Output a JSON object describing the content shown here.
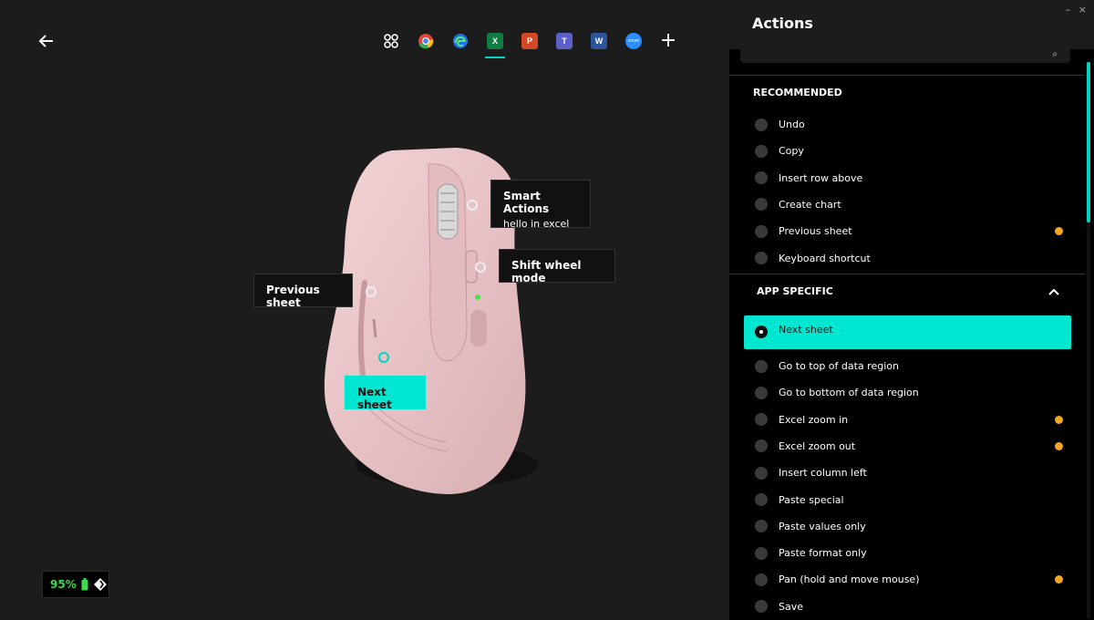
{
  "window": {
    "minimize": "–",
    "close": "×"
  },
  "apps": [
    {
      "name": "all-apps",
      "label": "",
      "color": "#ffffff"
    },
    {
      "name": "chrome",
      "label": "",
      "color": "#ea4335"
    },
    {
      "name": "edge",
      "label": "",
      "color": "#1a73e8"
    },
    {
      "name": "excel",
      "label": "X",
      "color": "#107c41",
      "active": true
    },
    {
      "name": "powerpoint",
      "label": "P",
      "color": "#d24726"
    },
    {
      "name": "teams",
      "label": "T",
      "color": "#5b5fc7"
    },
    {
      "name": "word",
      "label": "W",
      "color": "#2b579a"
    },
    {
      "name": "zoom",
      "label": "zoom",
      "color": "#2d8cff"
    },
    {
      "name": "add",
      "label": "+",
      "color": "#ffffff"
    }
  ],
  "callouts": {
    "smart_actions_title": "Smart Actions",
    "smart_actions_sub": "hello in excel",
    "shift_wheel": "Shift wheel mode",
    "previous_sheet": "Previous sheet",
    "next_sheet": "Next sheet"
  },
  "battery": {
    "percent": "95%"
  },
  "panel": {
    "title": "Actions",
    "recommended_label": "RECOMMENDED",
    "recommended": [
      {
        "label": "Undo",
        "badge": false
      },
      {
        "label": "Copy",
        "badge": false
      },
      {
        "label": "Insert row above",
        "badge": false
      },
      {
        "label": "Create chart",
        "badge": false
      },
      {
        "label": "Previous sheet",
        "badge": true
      },
      {
        "label": "Keyboard shortcut",
        "badge": false
      }
    ],
    "app_specific_label": "APP SPECIFIC",
    "selected": "Next sheet",
    "app_specific": [
      {
        "label": "Go to top of data region",
        "badge": false
      },
      {
        "label": "Go to bottom of data region",
        "badge": false
      },
      {
        "label": "Excel zoom in",
        "badge": true
      },
      {
        "label": "Excel zoom out",
        "badge": true
      },
      {
        "label": "Insert column left",
        "badge": false
      },
      {
        "label": "Paste special",
        "badge": false
      },
      {
        "label": "Paste values only",
        "badge": false
      },
      {
        "label": "Paste format only",
        "badge": false
      },
      {
        "label": "Pan (hold and move mouse)",
        "badge": true
      },
      {
        "label": "Save",
        "badge": false
      }
    ]
  },
  "colors": {
    "accent": "#00e6d0",
    "badge": "#f5a623",
    "battery": "#3ddc4b"
  }
}
